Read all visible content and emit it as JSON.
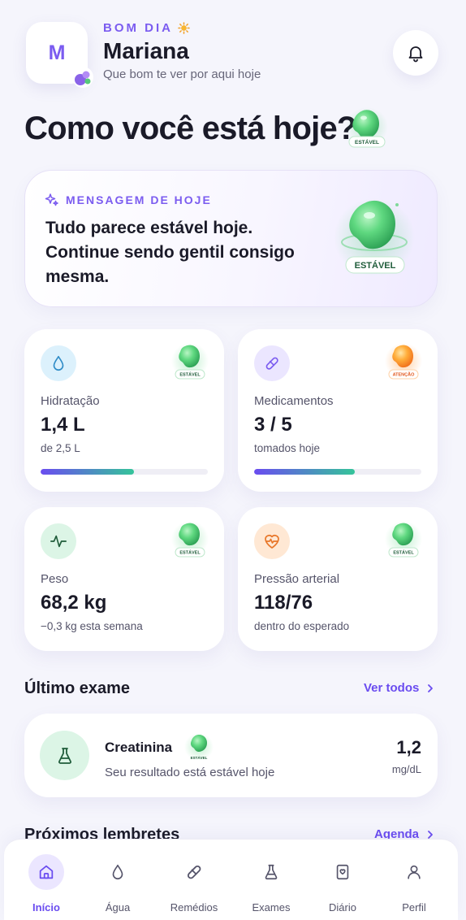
{
  "header": {
    "avatar_letter": "M",
    "greeting": "BOM DIA",
    "name": "Mariana",
    "subtitle": "Que bom te ver por aqui hoje"
  },
  "title": "Como você está hoje?",
  "status_badge": "ESTÁVEL",
  "message": {
    "label": "MENSAGEM DE HOJE",
    "text": "Tudo parece estável hoje. Continue sendo gentil consigo mesma.",
    "badge": "ESTÁVEL"
  },
  "metrics": [
    {
      "label": "Hidratação",
      "value": "1,4 L",
      "sub": "de 2,5 L",
      "progress": 0.56,
      "badge": "ESTÁVEL",
      "icon": "water-drop-icon",
      "color": "#3aa6e0"
    },
    {
      "label": "Medicamentos",
      "value": "3 / 5",
      "sub": "tomados hoje",
      "progress": 0.6,
      "badge": "ATENÇÃO",
      "icon": "pill-icon",
      "color": "#7b5cf0"
    },
    {
      "label": "Peso",
      "value": "68,2 kg",
      "sub": "−0,3 kg esta semana",
      "badge": "ESTÁVEL",
      "icon": "activity-icon",
      "color": "#1f5c3a"
    },
    {
      "label": "Pressão arterial",
      "value": "118/76",
      "sub": "dentro do esperado",
      "badge": "ESTÁVEL",
      "icon": "heart-pulse-icon",
      "color": "#f08a3a"
    }
  ],
  "last_exam": {
    "section_title": "Último exame",
    "link": "Ver todos",
    "name": "Creatinina",
    "badge": "ESTÁVEL",
    "desc": "Seu resultado está estável hoje",
    "value": "1,2",
    "unit": "mg/dL"
  },
  "reminders": {
    "section_title": "Próximos lembretes",
    "link": "Agenda"
  },
  "nav": [
    {
      "label": "Início",
      "icon": "home-icon",
      "active": true
    },
    {
      "label": "Água",
      "icon": "water-drop-icon",
      "active": false
    },
    {
      "label": "Remédios",
      "icon": "pill-icon",
      "active": false
    },
    {
      "label": "Exames",
      "icon": "flask-icon",
      "active": false
    },
    {
      "label": "Diário",
      "icon": "journal-icon",
      "active": false
    },
    {
      "label": "Perfil",
      "icon": "user-icon",
      "active": false
    }
  ],
  "colors": {
    "accent": "#6a4cf0",
    "stable_green": "#35c46a",
    "attention_orange": "#f59a2a",
    "background": "#f5f5fc"
  }
}
